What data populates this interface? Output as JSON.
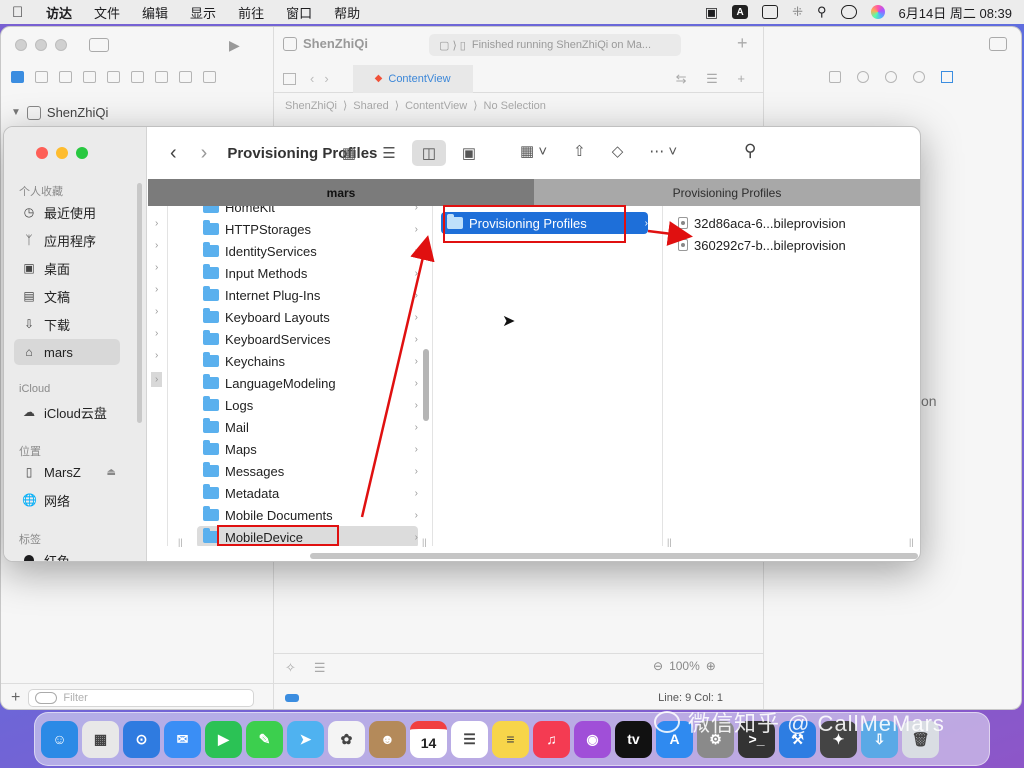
{
  "menubar": {
    "app_name": "访达",
    "items": [
      "文件",
      "编辑",
      "显示",
      "前往",
      "窗口",
      "帮助"
    ],
    "input_method": "A",
    "clock": "6月14日 周二  08:39"
  },
  "xcode": {
    "project": "ShenZhiQi",
    "status": "Finished running ShenZhiQi on Ma...",
    "tab": "ContentView",
    "breadcrumb": [
      "ShenZhiQi",
      "Shared",
      "ContentView",
      "No Selection"
    ],
    "tree_root": "ShenZhiQi",
    "partial_text": "on",
    "filter_placeholder": "Filter",
    "zoom": "100%",
    "line_col": "Line: 9  Col: 1"
  },
  "finder": {
    "title": "Provisioning Profiles",
    "tabs": [
      "mars",
      "Provisioning Profiles"
    ],
    "sidebar": {
      "favorites_header": "个人收藏",
      "favorites": [
        {
          "label": "最近使用",
          "icon": "clock-icon"
        },
        {
          "label": "应用程序",
          "icon": "apps-icon"
        },
        {
          "label": "桌面",
          "icon": "desktop-icon"
        },
        {
          "label": "文稿",
          "icon": "document-icon"
        },
        {
          "label": "下载",
          "icon": "download-icon"
        },
        {
          "label": "mars",
          "icon": "home-icon"
        }
      ],
      "icloud_header": "iCloud",
      "icloud": [
        {
          "label": "iCloud云盘",
          "icon": "cloud-icon"
        }
      ],
      "locations_header": "位置",
      "locations": [
        {
          "label": "MarsZ",
          "icon": "device-icon"
        },
        {
          "label": "网络",
          "icon": "network-icon"
        }
      ],
      "tags_header": "标签",
      "tags": [
        {
          "label": "红色",
          "color": "#1d1d1f"
        }
      ]
    },
    "column1": [
      "HomeKit",
      "HTTPStorages",
      "IdentityServices",
      "Input Methods",
      "Internet Plug-Ins",
      "Keyboard Layouts",
      "KeyboardServices",
      "Keychains",
      "LanguageModeling",
      "Logs",
      "Mail",
      "Maps",
      "Messages",
      "Metadata",
      "Mobile Documents",
      "MobileDevice"
    ],
    "column2": [
      "Provisioning Profiles"
    ],
    "column3": [
      "32d86aca-6...bileprovision",
      "360292c7-b...bileprovision"
    ]
  },
  "dock": {
    "apps": [
      {
        "name": "finder",
        "color": "#2b8ae6",
        "glyph": "☺"
      },
      {
        "name": "launchpad",
        "color": "#e8e8e8",
        "glyph": "▦"
      },
      {
        "name": "safari",
        "color": "#2f7be0",
        "glyph": "⊙"
      },
      {
        "name": "mail",
        "color": "#3a8ef5",
        "glyph": "✉"
      },
      {
        "name": "facetime",
        "color": "#2bc255",
        "glyph": "▶"
      },
      {
        "name": "messages",
        "color": "#3ccf4e",
        "glyph": "✎"
      },
      {
        "name": "maps",
        "color": "#4fb2f0",
        "glyph": "➤"
      },
      {
        "name": "photos",
        "color": "#f4f4f4",
        "glyph": "✿"
      },
      {
        "name": "contacts",
        "color": "#b48a5a",
        "glyph": "☻"
      },
      {
        "name": "calendar",
        "color": "#ffffff",
        "glyph": "14"
      },
      {
        "name": "reminders",
        "color": "#ffffff",
        "glyph": "☰"
      },
      {
        "name": "notes",
        "color": "#f7d54a",
        "glyph": "≡"
      },
      {
        "name": "music",
        "color": "#f43b52",
        "glyph": "♫"
      },
      {
        "name": "podcasts",
        "color": "#a04fd8",
        "glyph": "◉"
      },
      {
        "name": "tv",
        "color": "#111111",
        "glyph": "tv"
      },
      {
        "name": "app-store",
        "color": "#2f8af0",
        "glyph": "A"
      },
      {
        "name": "system-preferences",
        "color": "#8a8a8a",
        "glyph": "⚙"
      },
      {
        "name": "terminal",
        "color": "#333333",
        "glyph": ">_"
      },
      {
        "name": "xcode",
        "color": "#2d7de2",
        "glyph": "⚒"
      },
      {
        "name": "instruments",
        "color": "#444444",
        "glyph": "✦"
      },
      {
        "name": "downloads",
        "color": "#5aa9e6",
        "glyph": "⇩"
      },
      {
        "name": "trash",
        "color": "#d9dde3",
        "glyph": "🗑"
      }
    ],
    "watermark": "微信知乎 @ CallMeMars"
  }
}
